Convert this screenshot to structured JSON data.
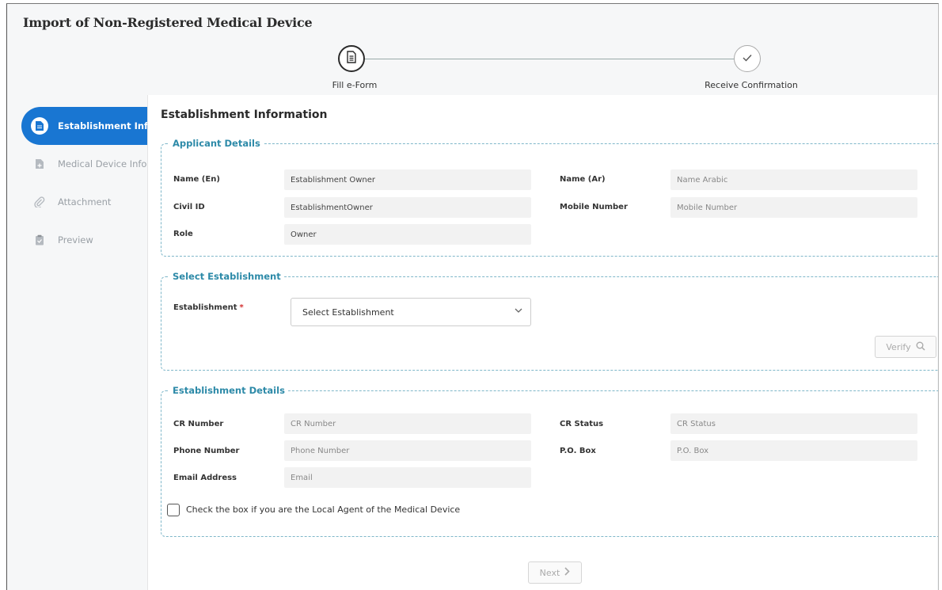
{
  "page": {
    "title": "Import of Non-Registered Medical Device"
  },
  "stepper": {
    "steps": [
      {
        "label": "Fill e-Form",
        "icon": "document-icon"
      },
      {
        "label": "Receive Confirmation",
        "icon": "check-icon"
      }
    ]
  },
  "sidebar": {
    "items": [
      {
        "label": "Establishment Info",
        "icon": "document-icon",
        "active": true
      },
      {
        "label": "Medical Device Info",
        "icon": "document-plus-icon",
        "active": false
      },
      {
        "label": "Attachment",
        "icon": "paperclip-icon",
        "active": false
      },
      {
        "label": "Preview",
        "icon": "clipboard-check-icon",
        "active": false
      }
    ]
  },
  "main": {
    "section_title": "Establishment Information",
    "applicant": {
      "legend": "Applicant Details",
      "name_en_label": "Name (En)",
      "name_en_value": "Establishment Owner",
      "name_ar_label": "Name (Ar)",
      "name_ar_placeholder": "Name Arabic",
      "civil_id_label": "Civil ID",
      "civil_id_value": "EstablishmentOwner",
      "mobile_label": "Mobile Number",
      "mobile_placeholder": "Mobile Number",
      "role_label": "Role",
      "role_value": "Owner"
    },
    "select_establishment": {
      "legend": "Select Establishment",
      "label": "Establishment",
      "required_mark": "*",
      "selected": "Select Establishment",
      "verify_label": "Verify"
    },
    "establishment_details": {
      "legend": "Establishment Details",
      "cr_number_label": "CR Number",
      "cr_number_placeholder": "CR Number",
      "cr_status_label": "CR Status",
      "cr_status_placeholder": "CR Status",
      "phone_label": "Phone Number",
      "phone_placeholder": "Phone Number",
      "po_box_label": "P.O. Box",
      "po_box_placeholder": "P.O. Box",
      "email_label": "Email Address",
      "email_placeholder": "Email",
      "local_agent_label": "Check the box if you are the Local Agent of the Medical Device",
      "local_agent_checked": false
    },
    "next_label": "Next"
  },
  "colors": {
    "accent": "#1976d2",
    "legend": "#2d8aa8",
    "required": "#d32f2f"
  }
}
